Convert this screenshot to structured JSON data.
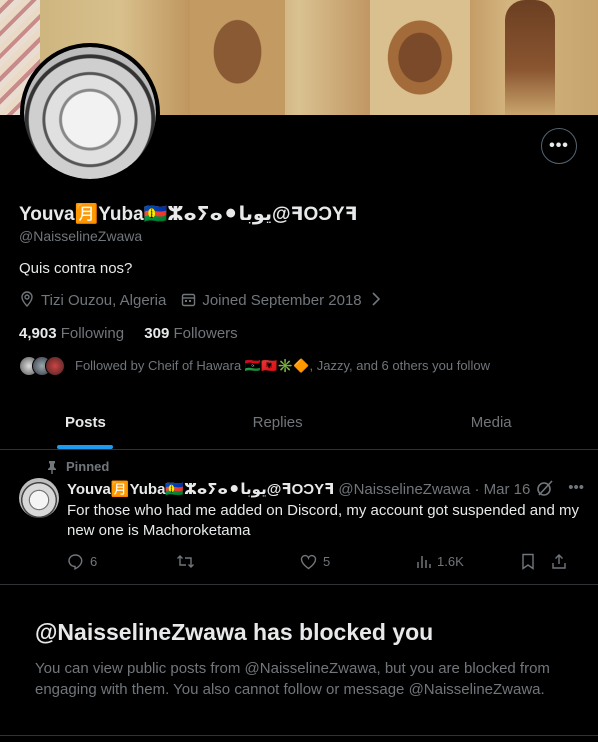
{
  "profile": {
    "display_name": "Youva🈷️Yuba🇳🇨ⵣⴰⵢⴰ⚫يوبا@ꟻOƆYꟻ",
    "handle": "@NaisselineZwawa",
    "bio": "Quis contra nos?",
    "location": "Tizi Ouzou, Algeria",
    "joined": "Joined September 2018",
    "following_count": "4,903",
    "following_label": "Following",
    "followers_count": "309",
    "followers_label": "Followers",
    "followed_by": "Followed by Cheif of Hawara 🇱🇾🇦🇱✳️🔶, Jazzy, and 6 others you follow"
  },
  "icons": {
    "more": "more-icon",
    "location": "location-pin-icon",
    "calendar": "calendar-icon",
    "chevron": "chevron-right-icon",
    "pin": "pin-icon"
  },
  "tabs": [
    {
      "label": "Posts"
    },
    {
      "label": "Replies"
    },
    {
      "label": "Media"
    }
  ],
  "pinned_post": {
    "pinned_label": "Pinned",
    "author_name": "Youva🈷️Yuba🇳🇨ⵣⴰⵢⴰ⚫يوبا@ꟻOƆYꟻ",
    "author_meta": "@NaisselineZwawa · Mar 16",
    "text": "For those who had me added on Discord, my account got suspended and my new one is Machoroketama",
    "replies": "6",
    "retweets": "",
    "likes": "5",
    "views": "1.6K"
  },
  "blocked": {
    "title": "@NaisselineZwawa has blocked you",
    "message": "You can view public posts from @NaisselineZwawa, but you are blocked from engaging with them. You also cannot follow or message @NaisselineZwawa."
  },
  "colors": {
    "accent": "#1d9bf0",
    "secondary_text": "#71767b",
    "background": "#000000"
  }
}
